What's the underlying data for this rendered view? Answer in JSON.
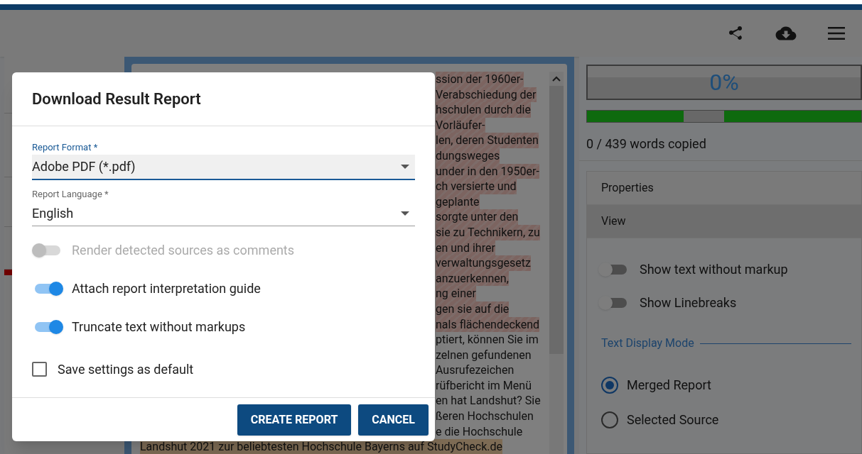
{
  "document": {
    "lines": [
      {
        "text": "ssion der 1960er-",
        "kind": "source",
        "covered": true
      },
      {
        "text": "Verabschiedung der",
        "kind": "source",
        "covered": true
      },
      {
        "text": "hschulen durch die",
        "kind": "source",
        "covered": true
      },
      {
        "text": "Vorläufer-",
        "kind": "source",
        "covered": true
      },
      {
        "text": "len, deren Studenten",
        "kind": "source",
        "covered": true
      },
      {
        "text": "dungsweges",
        "kind": "source",
        "covered": true
      },
      {
        "text": "under in den 1950er-",
        "kind": "source",
        "covered": true
      },
      {
        "text": "ch versierte und",
        "kind": "source",
        "covered": true
      },
      {
        "text": "geplante",
        "kind": "source",
        "covered": true
      },
      {
        "text": "sorgte unter den",
        "kind": "source",
        "covered": true
      },
      {
        "text": "sie zu Technikern, zu",
        "kind": "source",
        "covered": true
      },
      {
        "text": "en und ihrer",
        "kind": "source",
        "covered": true
      },
      {
        "text": "verwaltungsgesetz",
        "kind": "source",
        "covered": true
      },
      {
        "text": "anzuerkennen,",
        "kind": "source",
        "covered": true
      },
      {
        "text": "ng einer",
        "kind": "source",
        "covered": true
      },
      {
        "text": "gen sie auf die",
        "kind": "source",
        "covered": true
      },
      {
        "text": "nals flächendeckend",
        "kind": "source",
        "covered": true
      },
      {
        "text": "ptiert, können Sie im",
        "kind": "none",
        "covered": true
      },
      {
        "text": "zelnen gefundenen",
        "kind": "none",
        "covered": true
      },
      {
        "text": "Ausrufezeichen",
        "kind": "none",
        "covered": true
      },
      {
        "text": "rüfbericht im Menü",
        "kind": "none",
        "covered": true
      },
      {
        "text": "en hat Landshut? Sie",
        "kind": "none",
        "covered": true
      },
      {
        "text": "ßeren Hochschulen",
        "kind": "none",
        "covered": true
      },
      {
        "text": "e die Hochschule",
        "kind": "none",
        "covered": true
      },
      {
        "text": "Landshut 2021 zur beliebtesten Hochschule Bayerns auf StudyCheck.de",
        "kind": "citation",
        "covered": false
      }
    ]
  },
  "results": {
    "percent": "0%",
    "words_copied": "0 / 439 words copied",
    "sections": [
      {
        "label": "Properties",
        "selected": false
      },
      {
        "label": "View",
        "selected": true
      }
    ],
    "view_options": [
      {
        "label": "Show text without markup",
        "on": false
      },
      {
        "label": "Show Linebreaks",
        "on": false
      }
    ],
    "text_display_mode": {
      "legend": "Text Display Mode",
      "options": [
        {
          "label": "Merged Report",
          "selected": true
        },
        {
          "label": "Selected Source",
          "selected": false
        }
      ]
    }
  },
  "dialog": {
    "title": "Download Result Report",
    "fields": [
      {
        "label": "Report Format *",
        "value": "Adobe PDF (*.pdf)",
        "focused": true
      },
      {
        "label": "Report Language *",
        "value": "English",
        "focused": false
      }
    ],
    "toggles": [
      {
        "label": "Render detected sources as comments",
        "on": false,
        "disabled": true
      },
      {
        "label": "Attach report interpretation guide",
        "on": true,
        "disabled": false
      },
      {
        "label": "Truncate text without markups",
        "on": true,
        "disabled": false
      }
    ],
    "checkbox": {
      "label": "Save settings as default",
      "checked": false
    },
    "buttons": [
      "CREATE REPORT",
      "CANCEL"
    ]
  }
}
